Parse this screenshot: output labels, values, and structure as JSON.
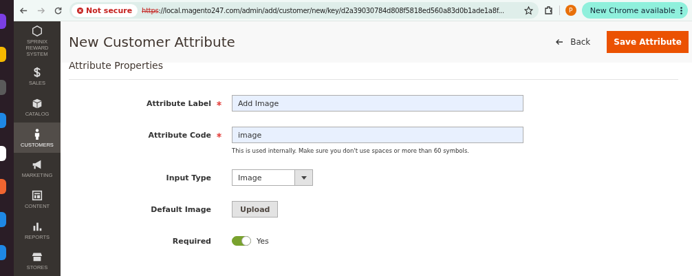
{
  "browser": {
    "security": "Not secure",
    "url_scheme": "https",
    "url_rest": "://local.magento247.com/admin/add/customer/new/key/d2a39030784d808f5818ed560a83d0b1ade1a8f...",
    "profile_initial": "P",
    "update_button": "New Chrome available"
  },
  "dock": [
    {
      "color": "#7b3fe4"
    },
    {
      "color": "#f5b800"
    },
    {
      "color": "#5a5a5a"
    },
    {
      "color": "#1e88e5"
    },
    {
      "color": "#ffffff"
    },
    {
      "color": "#f06530"
    },
    {
      "color": "#1e88e5"
    },
    {
      "color": "#1e88e5"
    }
  ],
  "sidebar": {
    "items": [
      {
        "kind": "hexagon",
        "lines": [
          "SPRINIX",
          "REWARD",
          "SYSTEM"
        ],
        "selected": false
      },
      {
        "kind": "dollar",
        "lines": [
          "SALES"
        ],
        "selected": false
      },
      {
        "kind": "box",
        "lines": [
          "CATALOG"
        ],
        "selected": false
      },
      {
        "kind": "person",
        "lines": [
          "CUSTOMERS"
        ],
        "selected": true
      },
      {
        "kind": "megaphone",
        "lines": [
          "MARKETING"
        ],
        "selected": false
      },
      {
        "kind": "layout",
        "lines": [
          "CONTENT"
        ],
        "selected": false
      },
      {
        "kind": "bars",
        "lines": [
          "REPORTS"
        ],
        "selected": false
      },
      {
        "kind": "store",
        "lines": [
          "STORES"
        ],
        "selected": false
      }
    ]
  },
  "page": {
    "title": "New Customer Attribute",
    "back": "Back",
    "save": "Save Attribute",
    "section_title": "Attribute Properties"
  },
  "fields": [
    {
      "kind": "text",
      "label": "Attribute Label",
      "required": true,
      "value": "Add Image"
    },
    {
      "kind": "text",
      "label": "Attribute Code",
      "required": true,
      "value": "image",
      "note": "This is used internally. Make sure you don't use spaces or more than 60 symbols."
    },
    {
      "kind": "select",
      "label": "Input Type",
      "required": false,
      "value": "Image"
    },
    {
      "kind": "upload",
      "label": "Default Image",
      "required": false,
      "value": "Upload"
    },
    {
      "kind": "toggle",
      "label": "Required",
      "required": false,
      "on": true,
      "value": "Yes"
    }
  ]
}
